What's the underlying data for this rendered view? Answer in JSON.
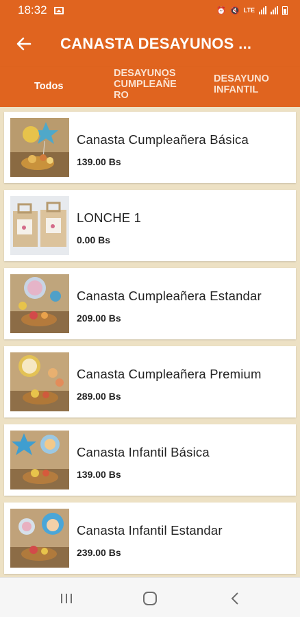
{
  "status_bar": {
    "time": "18:32",
    "network_label": "LTE"
  },
  "app_bar": {
    "title": "CANASTA DESAYUNOS ..."
  },
  "tabs": [
    {
      "label": "Todos",
      "active": true
    },
    {
      "label": "DESAYUNOS CUMPLEAÑERO",
      "active": false
    },
    {
      "label": "DESAYUNO INFANTIL",
      "active": false
    }
  ],
  "products": [
    {
      "name": "Canasta Cumpleañera Básica",
      "price": "139.00 Bs"
    },
    {
      "name": "LONCHE 1",
      "price": "0.00 Bs"
    },
    {
      "name": "Canasta Cumpleañera Estandar",
      "price": "209.00 Bs"
    },
    {
      "name": "Canasta Cumpleañera Premium",
      "price": "289.00 Bs"
    },
    {
      "name": "Canasta Infantil Básica",
      "price": "139.00 Bs"
    },
    {
      "name": "Canasta Infantil Estandar",
      "price": "239.00 Bs"
    }
  ],
  "icons": {
    "back": "arrow-left-icon",
    "recents": "recent-apps-icon",
    "home": "home-icon",
    "nav_back": "chevron-left-icon"
  },
  "colors": {
    "primary": "#e0641f",
    "list_background": "#ede1c4"
  }
}
